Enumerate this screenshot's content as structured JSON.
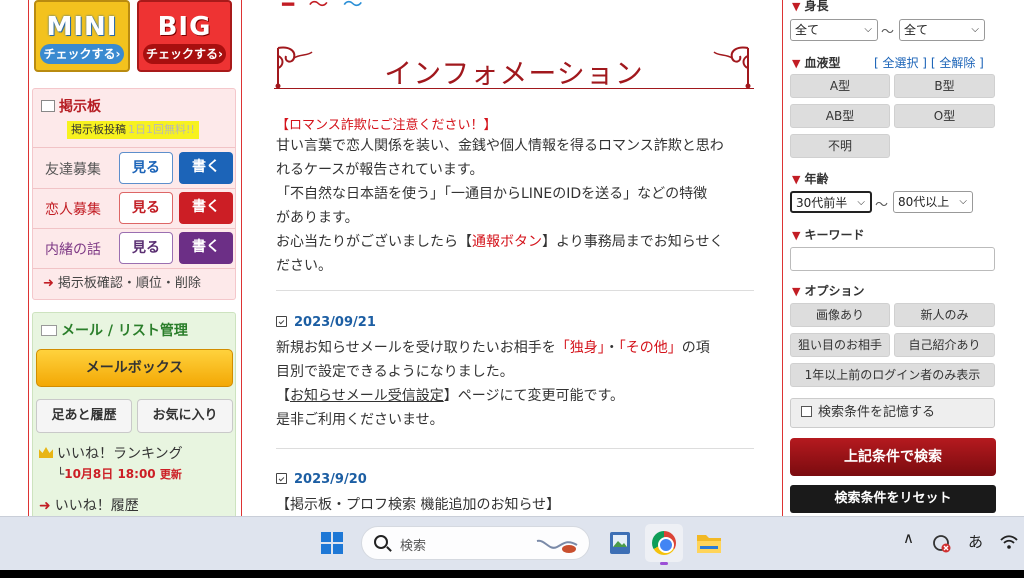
{
  "promos": {
    "mini_title": "MINI",
    "big_title": "BIG",
    "mini_check": "チェックする›",
    "big_check": "チェックする›"
  },
  "board": {
    "title": "掲示板",
    "tag": "掲示板投稿",
    "tag_note": "1日1回無料!!",
    "rows": [
      {
        "label": "友達募集",
        "view": "見る",
        "write": "書く"
      },
      {
        "label": "恋人募集",
        "view": "見る",
        "write": "書く"
      },
      {
        "label": "内緒の話",
        "view": "見る",
        "write": "書く"
      }
    ],
    "link": "掲示板確認・順位・削除"
  },
  "mail": {
    "title": "メール / リスト管理",
    "mailbox": "メールボックス",
    "footprints": "足あと履歴",
    "favorites": "お気に入り",
    "ranking": "いいね！ランキング",
    "ranking_date": "10月8日 18:00",
    "ranking_update": "更新",
    "like_history": "いいね！履歴"
  },
  "main": {
    "title": "インフォメーション",
    "alert": "【ロマンス詐欺にご注意ください！】",
    "p1_line1": "甘い言葉で恋人関係を装い、金銭や個人情報を得るロマンス詐欺と思わ",
    "p1_line2": "れるケースが報告されています。",
    "p1_line3": "「不自然な日本語を使う」「一通目からLINEのIDを送る」などの特徴",
    "p1_line4": "があります。",
    "p1_line5a": "お心当たりがございましたら【",
    "p1_report": "通報ボタン",
    "p1_line5b": "】より事務局までお知らせく",
    "p1_line6": "ださい。",
    "news": [
      {
        "date": "2023/09/21",
        "l1a": "新規お知らせメールを受け取りたいお相手を",
        "l1b": "「独身」",
        "l1c": "・",
        "l1d": "「その他」",
        "l1e": "の項",
        "l2": "目別で設定できるようになりました。",
        "l3a": "【",
        "l3b": "お知らせメール受信設定",
        "l3c": "】ページにて変更可能です。",
        "l4": "是非ご利用くださいませ。"
      },
      {
        "date": "2023/9/20",
        "l1": "【掲示板・プロフ検索 機能追加のお知らせ】"
      }
    ]
  },
  "search": {
    "height_label": "身長",
    "height_from": "全て",
    "height_to": "全て",
    "blood_label": "血液型",
    "select_all": "[ 全選択 ]",
    "clear_all": "[ 全解除 ]",
    "blood_types": [
      "A型",
      "B型",
      "AB型",
      "O型",
      "不明"
    ],
    "age_label": "年齢",
    "age_from": "30代前半",
    "age_to": "80代以上",
    "tilde": "〜",
    "keyword_label": "キーワード",
    "option_label": "オプション",
    "options": [
      "画像あり",
      "新人のみ",
      "狙い目のお相手",
      "自己紹介あり",
      "1年以上前のログイン者のみ表示"
    ],
    "remember": "検索条件を記憶する",
    "search_button": "上記条件で検索",
    "reset_button": "検索条件をリセット"
  },
  "taskbar": {
    "search_placeholder": "検索",
    "ime": "あ",
    "chevron": "∧"
  }
}
